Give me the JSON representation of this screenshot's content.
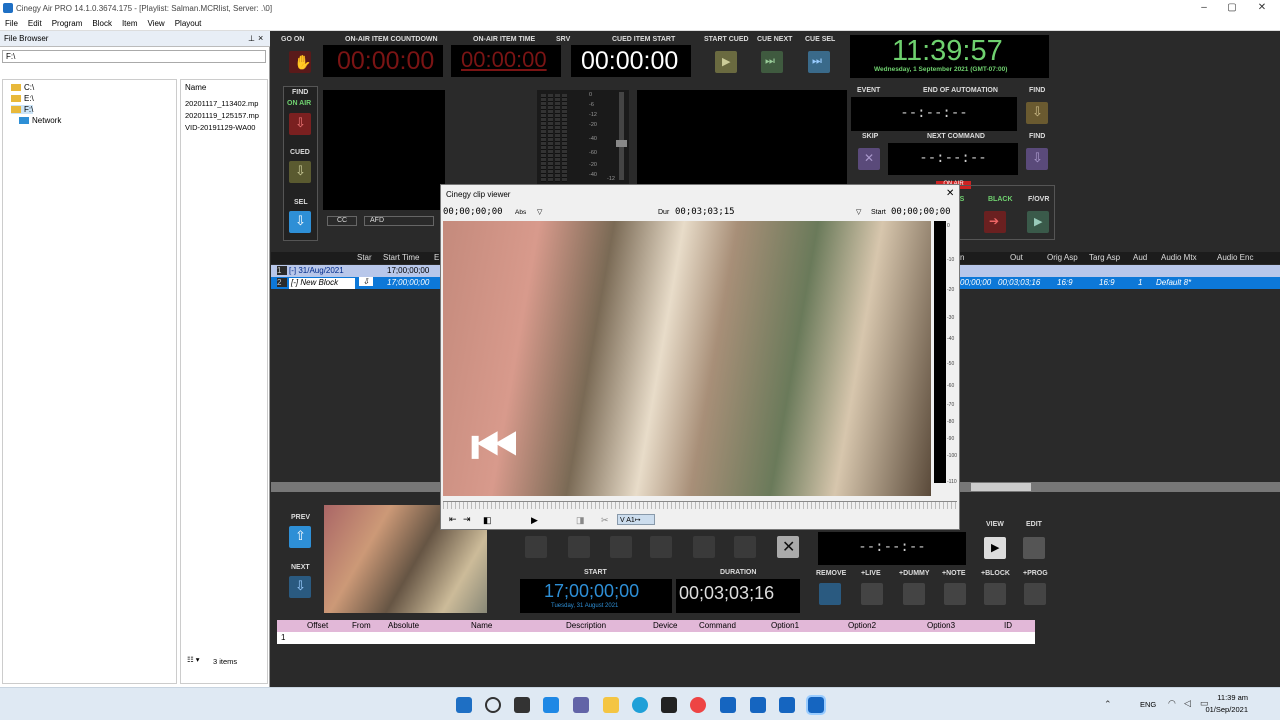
{
  "window": {
    "title": "Cinegy Air PRO 14.1.0.3674.175 - [Playlist: Salman.MCRlist, Server: .\\0]"
  },
  "menu": [
    "File",
    "Edit",
    "Program",
    "Block",
    "Item",
    "View",
    "Playout"
  ],
  "file_browser": {
    "title": "File Browser",
    "pin": "⊥",
    "close": "×",
    "path": "F:\\",
    "tree": [
      "C:\\",
      "E:\\",
      "F:\\",
      "Network"
    ],
    "name_header": "Name",
    "files": [
      "20201117_113402.mp",
      "20201119_125157.mp",
      "VID-20191129-WA00"
    ],
    "footer": "3 items",
    "view_icon": "☷ ▾"
  },
  "top": {
    "go_on": "GO ON",
    "on_air_countdown_label": "ON-AIR ITEM COUNTDOWN",
    "on_air_countdown": "00:00:00",
    "on_air_time_label": "ON-AIR ITEM TIME",
    "on_air_time": "00:00:00",
    "srv": "SRV",
    "cued_start_label": "CUED ITEM START",
    "cued_start": "00:00:00",
    "start_cued": "START CUED",
    "cue_next": "CUE NEXT",
    "cue_sel": "CUE SEL",
    "clock": "11:39:57",
    "date": "Wednesday, 1 September 2021 (GMT-07:00)",
    "find": "FIND",
    "on_air": "ON AIR",
    "cued": "CUED",
    "sel": "SEL",
    "cc": "CC",
    "afd": "AFD",
    "event": "EVENT",
    "end_of_automation": "END OF AUTOMATION",
    "skip": "SKIP",
    "next_command": "NEXT COMMAND",
    "dash_time": "--:--:--",
    "find2": "FIND",
    "find3": "FIND",
    "black": "BLACK",
    "fovr": "F/OVR",
    "ss": "SS",
    "onair_red": "ON AIR"
  },
  "vu_scale": [
    "0",
    "-6",
    "-12",
    "-20",
    "-40",
    "-60",
    "-20",
    "-40",
    "-60",
    "-12"
  ],
  "playlist": {
    "headers": [
      "Star",
      "Start Time",
      "E"
    ],
    "right_headers": [
      "n",
      "Out",
      "Orig Asp",
      "Targ Asp",
      "Aud",
      "Audio Mtx",
      "Audio Enc"
    ],
    "rows": [
      {
        "num": "1",
        "name": "[-] 31/Aug/2021",
        "star": "",
        "start": "17;00;00;00"
      },
      {
        "num": "2",
        "name": "[-] New Block",
        "star": "⇩",
        "start": "17;00;00;00"
      }
    ],
    "row2_right": {
      "in": "00;00;00",
      "out": "00;03;03;16",
      "orig": "16:9",
      "targ": "16:9",
      "aud": "1",
      "mtx": "Default 8*"
    }
  },
  "viewer": {
    "title": "Cinegy clip viewer",
    "pos": "00;00;00;00",
    "abs": "Abs",
    "dur_label": "Dur",
    "dur": "00;03;03;15",
    "start_label": "Start",
    "start": "00;00;00;00",
    "scale": [
      "0",
      "-10",
      "-20",
      "-30",
      "-40",
      "-50",
      "-60",
      "-70",
      "-80",
      "-90",
      "-100",
      "-110"
    ],
    "track": "V A1↦"
  },
  "bottom": {
    "prev": "PREV",
    "next": "NEXT",
    "start_label": "START",
    "start": "17;00;00;00",
    "start_date": "Tuesday, 31 August 2021",
    "duration_label": "DURATION",
    "duration": "00;03;03;16",
    "view": "VIEW",
    "edit": "EDIT",
    "dash_time": "--:--:--",
    "remove": "REMOVE",
    "live": "+LIVE",
    "dummy": "+DUMMY",
    "note": "+NOTE",
    "block": "+BLOCK",
    "prog": "+PROG"
  },
  "cmd_table": {
    "headers": [
      "Offset",
      "From",
      "Absolute",
      "Name",
      "Description",
      "Device",
      "Command",
      "Option1",
      "Option2",
      "Option3",
      "ID"
    ],
    "row": "1"
  },
  "taskbar": {
    "lang": "ENG",
    "time": "11:39 am",
    "date": "01/Sep/2021"
  },
  "colors": {
    "accent": "#2e8fd6",
    "timer_red": "#7a1414",
    "clock_green": "#6fd16f",
    "row_sel": "#0d78d8"
  }
}
